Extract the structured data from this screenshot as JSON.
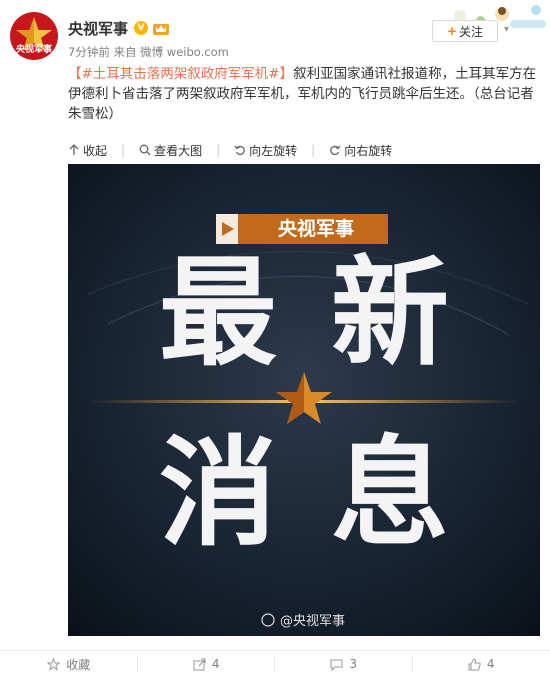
{
  "post": {
    "author": "央视军事",
    "avatar_text": "央视军事",
    "time": "7分钟前",
    "source_label": "来自",
    "source": "微博 weibo.com",
    "follow_label": "关注",
    "topic": "【#土耳其击落两架叙政府军军机#】",
    "text": "叙利亚国家通讯社报道称，土耳其军方在伊德利卜省击落了两架叙政府军军机，军机内的飞行员跳伞后生还。（总台记者朱雪松）"
  },
  "toolbar": {
    "collapse": "收起",
    "view_large": "查看大图",
    "rotate_left": "向左旋转",
    "rotate_right": "向右旋转"
  },
  "image": {
    "logo_text": "央视军事",
    "line1_char1": "最",
    "line1_char2": "新",
    "line2_char1": "消",
    "line2_char2": "息",
    "watermark": "@央视军事"
  },
  "actions": {
    "favorite": "收藏",
    "repost": "4",
    "comment": "3",
    "like": "4"
  },
  "colors": {
    "accent_orange": "#ff8200",
    "topic_color": "#eb7350",
    "brand_red": "#c8161d"
  }
}
